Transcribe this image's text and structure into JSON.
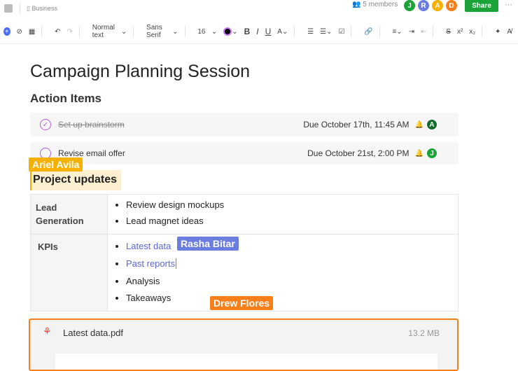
{
  "header": {
    "breadcrumb": "Business",
    "members": "5 members",
    "avatars": [
      {
        "l": "J",
        "c": "#1aa336"
      },
      {
        "l": "R",
        "c": "#6b7de0"
      },
      {
        "l": "A",
        "c": "#f6b100"
      },
      {
        "l": "D",
        "c": "#f77f1a"
      }
    ],
    "share": "Share",
    "more": "···"
  },
  "toolbar": {
    "style": "Normal text",
    "font": "Sans Serif",
    "size": "16"
  },
  "doc": {
    "title": "Campaign Planning Session",
    "subtitle": "Action Items",
    "tasks": [
      {
        "text": "Set up brainstorm",
        "due": "Due October 17th, 11:45 AM",
        "assignee": "A",
        "color": "#0f6b2a",
        "done": true
      },
      {
        "text": "Revise email offer",
        "due": "Due October 21st, 2:00 PM",
        "assignee": "J",
        "color": "#1aa336",
        "done": false
      }
    ],
    "section": "Project updates",
    "table": [
      {
        "label": "Lead Generation",
        "items": [
          "Review design mockups",
          "Lead magnet ideas"
        ]
      },
      {
        "label": "KPIs",
        "links": [
          "Latest data",
          "Past reports"
        ],
        "items": [
          "Analysis",
          "Takeaways"
        ]
      }
    ],
    "file": {
      "name": "Latest data.pdf",
      "size": "13.2 MB"
    }
  },
  "cursors": [
    {
      "name": "Ariel Avila",
      "color": "#f6b100"
    },
    {
      "name": "Rasha Bitar",
      "color": "#6b7de0"
    },
    {
      "name": "Drew Flores",
      "color": "#f77f1a"
    }
  ]
}
